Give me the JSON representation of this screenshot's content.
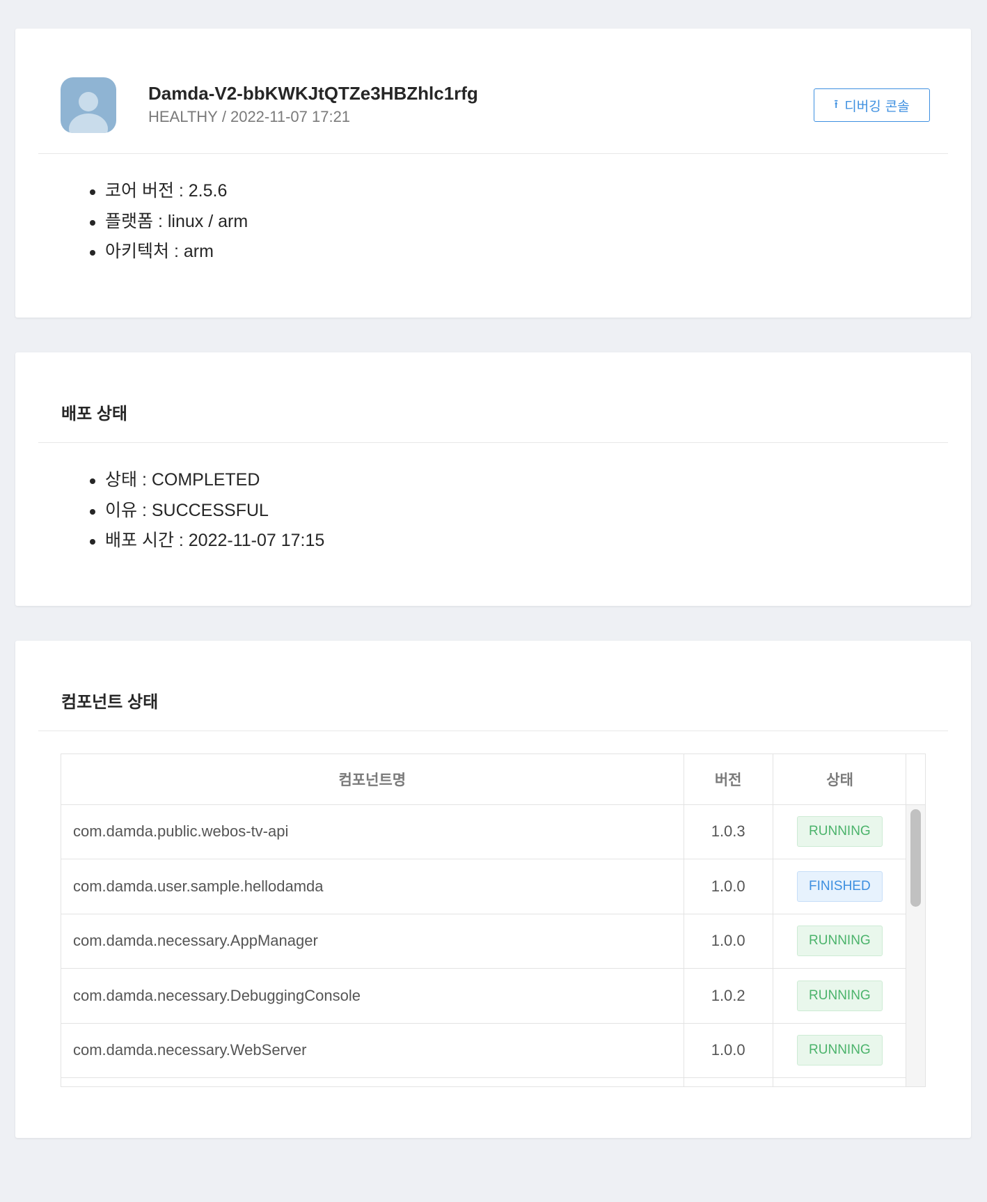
{
  "device": {
    "name": "Damda-V2-bbKWKJtQTZe3HBZhlc1rfg",
    "status": "HEALTHY",
    "separator": "/",
    "timestamp": "2022-11-07 17:21",
    "debug_button_label": "디버깅 콘솔",
    "debug_button_icon": "upload-icon",
    "info": [
      "코어 버전 : 2.5.6",
      "플랫폼 : linux / arm",
      "아키텍처 : arm"
    ]
  },
  "deploy": {
    "title": "배포 상태",
    "info": [
      "상태 : COMPLETED",
      "이유 : SUCCESSFUL",
      "배포 시간 : 2022-11-07 17:15"
    ]
  },
  "components": {
    "title": "컴포넌트 상태",
    "headers": [
      "컴포넌트명",
      "버전",
      "상태"
    ],
    "rows": [
      {
        "name": "com.damda.public.webos-tv-api",
        "version": "1.0.3",
        "status": "RUNNING"
      },
      {
        "name": "com.damda.user.sample.hellodamda",
        "version": "1.0.0",
        "status": "FINISHED"
      },
      {
        "name": "com.damda.necessary.AppManager",
        "version": "1.0.0",
        "status": "RUNNING"
      },
      {
        "name": "com.damda.necessary.DebuggingConsole",
        "version": "1.0.2",
        "status": "RUNNING"
      },
      {
        "name": "com.damda.necessary.WebServer",
        "version": "1.0.0",
        "status": "RUNNING"
      }
    ]
  },
  "colors": {
    "background": "#eef0f4",
    "accent": "#3d8fe0",
    "running": "#4bb36b",
    "finished": "#3d8fe0"
  }
}
